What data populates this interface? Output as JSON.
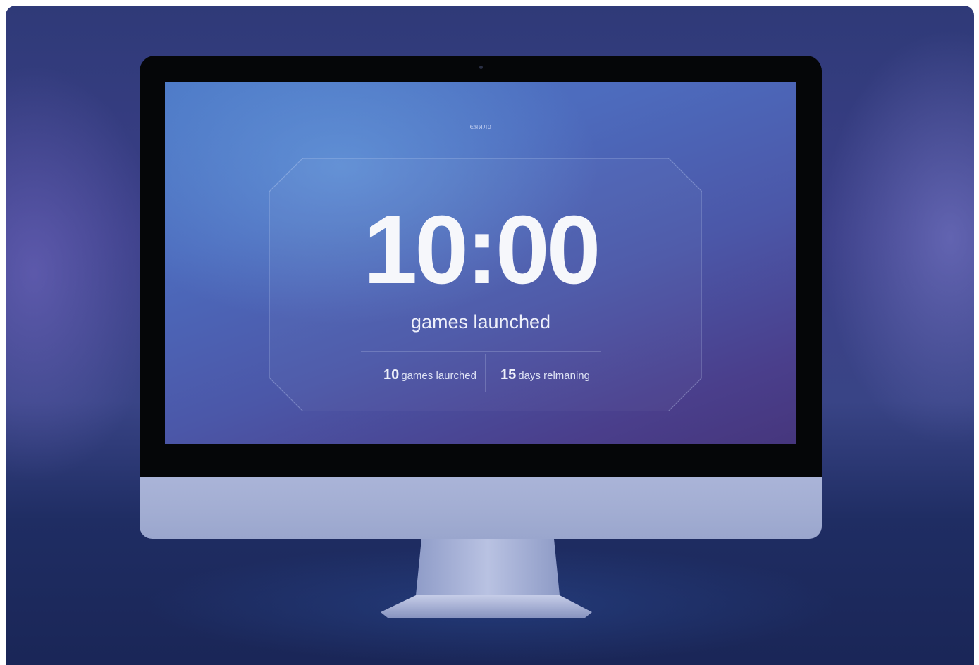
{
  "screen": {
    "brand_label": "ЄЯИЛ0",
    "timer": "10:00",
    "subtitle": "games launched",
    "stats": [
      {
        "number": "10",
        "label": "games laurched"
      },
      {
        "number": "15",
        "label": "days relmaning"
      }
    ]
  },
  "colors": {
    "background": "#2f3a78",
    "screen_top": "#4c78c6",
    "screen_bottom": "#46367d",
    "text": "#f6f7fb",
    "monitor_bezel": "#050608",
    "monitor_chin": "#a3aed3"
  }
}
